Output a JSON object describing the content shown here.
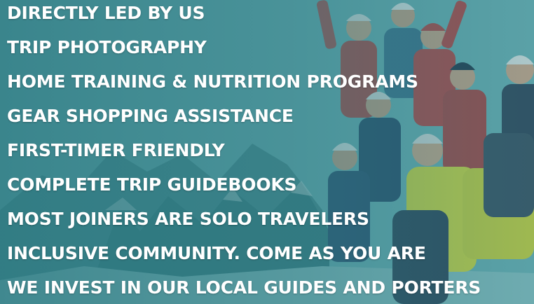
{
  "features": [
    "DIRECTLY LED BY US",
    "TRIP PHOTOGRAPHY",
    "HOME TRAINING & NUTRITION PROGRAMS",
    "GEAR SHOPPING ASSISTANCE",
    "FIRST-TIMER FRIENDLY",
    "COMPLETE TRIP GUIDEBOOKS",
    "MOST JOINERS ARE SOLO TRAVELERS",
    "INCLUSIVE COMMUNITY. COME AS YOU ARE",
    "WE INVEST IN OUR LOCAL GUIDES AND PORTERS"
  ],
  "colors": {
    "overlay_teal": "#2b7880",
    "text": "#ffffff",
    "jacket_red": "#c43a3a",
    "jacket_yellow": "#e3e23a"
  },
  "background": {
    "icon": "group-of-climbers-photo"
  }
}
